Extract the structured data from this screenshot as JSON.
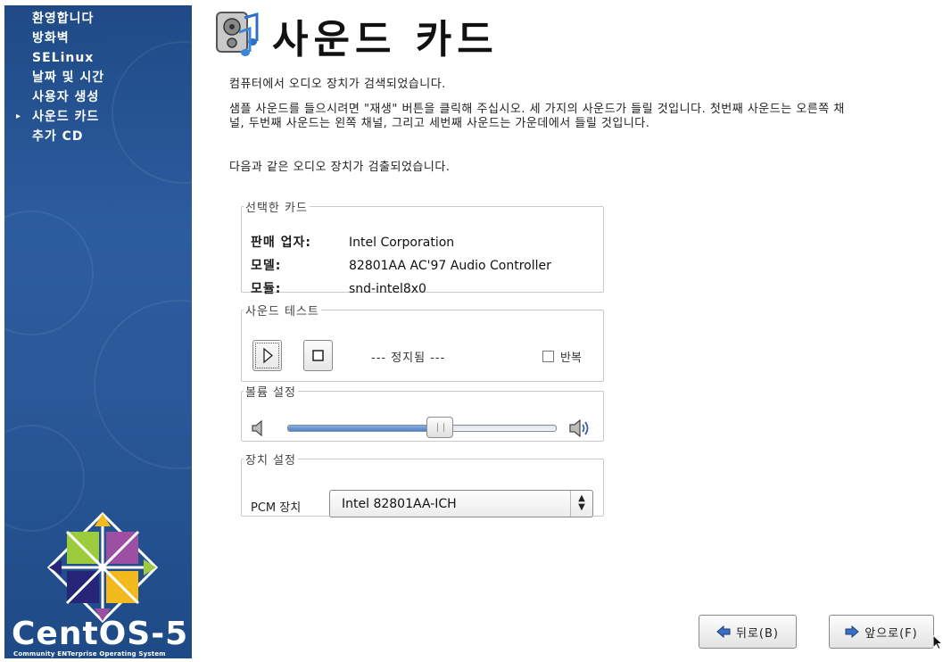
{
  "sidebar": {
    "items": [
      {
        "label": "환영합니다",
        "current": false
      },
      {
        "label": "방화벽",
        "current": false
      },
      {
        "label": "SELinux",
        "current": false
      },
      {
        "label": "날짜 및 시간",
        "current": false
      },
      {
        "label": "사용자 생성",
        "current": false
      },
      {
        "label": "사운드 카드",
        "current": true
      },
      {
        "label": "추가 CD",
        "current": false
      }
    ],
    "current_marker": "▸",
    "brand": "CentOS-5",
    "brand_sub": "Community ENTerprise Operating System"
  },
  "main": {
    "title": "사운드 카드",
    "intro": "컴퓨터에서 오디오 장치가 검색되었습니다.",
    "description": "샘플 사운드를 들으시려면 \"재생\" 버튼을 클릭해 주십시오. 세 가지의 사운드가 들릴 것입니다. 첫번째 사운드는 오른쪽 채널, 두번째 사운드는 왼쪽 채널, 그리고 세번째 사운드는 가운데에서 들릴 것입니다.",
    "found": "다음과 같은 오디오 장치가 검출되었습니다."
  },
  "card": {
    "legend": "선택한 카드",
    "vendor_label": "판매 업자:",
    "vendor": "Intel Corporation",
    "model_label": "모델:",
    "model": "82801AA AC'97 Audio Controller",
    "module_label": "모듈:",
    "module": "snd-intel8x0"
  },
  "test": {
    "legend": "사운드 테스트",
    "status": "--- 정지됨 ---",
    "repeat_label": "반복",
    "repeat_checked": false
  },
  "volume": {
    "legend": "볼륨 설정",
    "level": 0.57
  },
  "device": {
    "legend": "장치 설정",
    "pcm_label": "PCM 장치",
    "pcm_value": "Intel 82801AA-ICH"
  },
  "buttons": {
    "back": "뒤로(B)",
    "next": "앞으로(F)"
  },
  "colors": {
    "sidebar": "#2c5d9f",
    "slider_fill": "#4f7fc4"
  }
}
